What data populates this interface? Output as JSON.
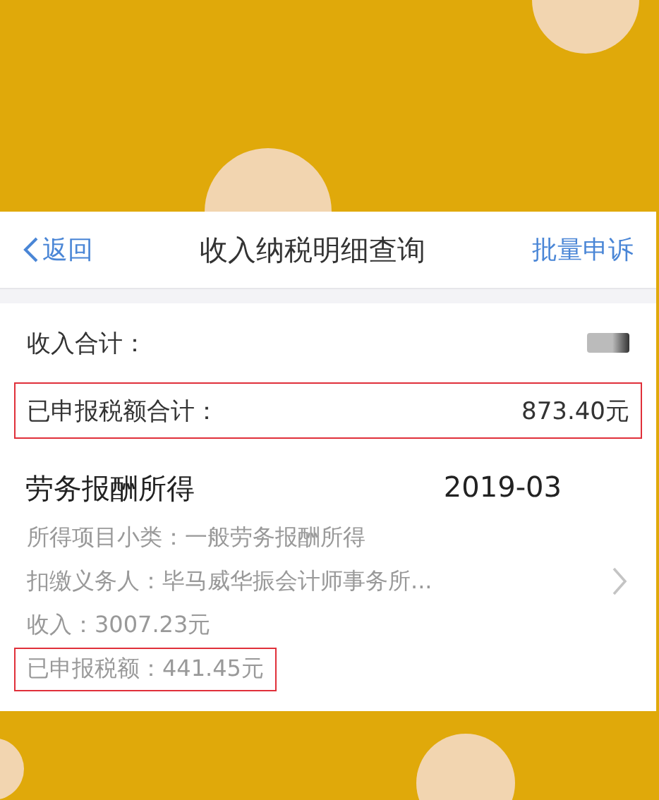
{
  "nav": {
    "back": "返回",
    "title": "收入纳税明细查询",
    "action": "批量申诉"
  },
  "summary": [
    {
      "kind": "redacted",
      "label": "收入合计：",
      "highlighted": false
    },
    {
      "kind": "amount",
      "label": "已申报税额合计：",
      "value": "873.40元",
      "highlighted": true
    }
  ],
  "record": {
    "title": "劳务报酬所得",
    "date": "2019-03",
    "lines": [
      {
        "text": "所得项目小类：一般劳务报酬所得",
        "highlighted": false
      },
      {
        "text": "扣缴义务人：毕马威华振会计师事务所...",
        "highlighted": false
      },
      {
        "text": "收入：3007.23元",
        "highlighted": false
      },
      {
        "text": "已申报税额：441.45元",
        "highlighted": true
      }
    ]
  }
}
